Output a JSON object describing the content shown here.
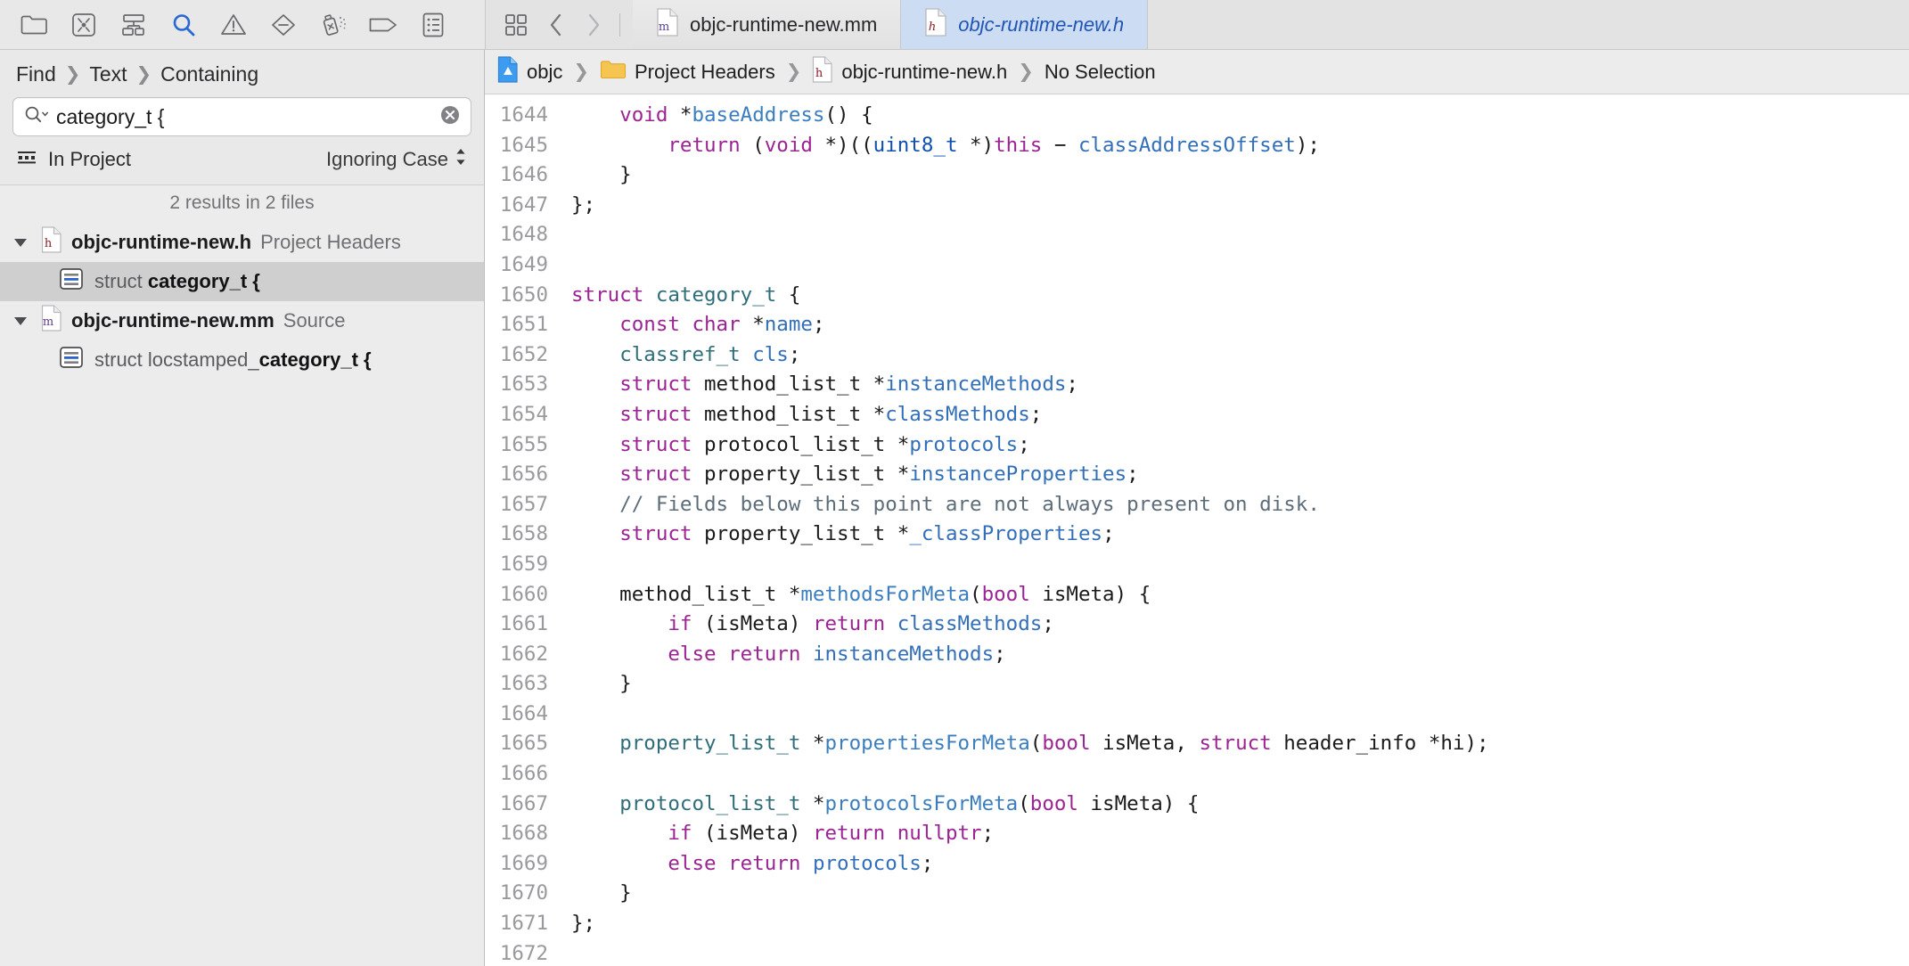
{
  "navigator_toolbar": {
    "icons": [
      {
        "name": "folder-icon",
        "title": "Project navigator"
      },
      {
        "name": "source-control-icon",
        "title": "Source control navigator"
      },
      {
        "name": "hierarchy-icon",
        "title": "Symbol navigator"
      },
      {
        "name": "search-icon",
        "title": "Find navigator"
      },
      {
        "name": "warning-triangle-icon",
        "title": "Issue navigator"
      },
      {
        "name": "diamond-minus-icon",
        "title": "Test navigator"
      },
      {
        "name": "spray-can-icon",
        "title": "Debug navigator"
      },
      {
        "name": "tag-icon",
        "title": "Breakpoint navigator"
      },
      {
        "name": "report-list-icon",
        "title": "Report navigator"
      }
    ],
    "selected_icon": "search-icon"
  },
  "editor_toolbar": {
    "grid_icon": "grid-squares-icon",
    "back_icon": "chevron-left-icon",
    "forward_icon": "chevron-right-icon"
  },
  "tabs": [
    {
      "label": "objc-runtime-new.mm",
      "badge": "m",
      "badge_color": "#5c3d8f",
      "active": false
    },
    {
      "label": "objc-runtime-new.h",
      "badge": "h",
      "badge_color": "#8d1b22",
      "active": true
    }
  ],
  "find": {
    "breadcrumb": [
      "Find",
      "Text",
      "Containing"
    ],
    "breadcrumb_sep": "›",
    "search_value": "category_t {",
    "search_placeholder": "Search",
    "scope_label": "In Project",
    "scope_icon": "scope-icon",
    "options_label": "Ignoring Case",
    "options_icon": "updown-chevron-icon",
    "clear_icon": "clear-circle-icon",
    "results_summary": "2 results in 2 files",
    "results": [
      {
        "file": "objc-runtime-new.h",
        "kind": "Project Headers",
        "badge": "h",
        "badge_color": "#8d1b22",
        "expanded": true,
        "matches": [
          {
            "prefix": "struct ",
            "match": "category_t {",
            "suffix": "",
            "selected": true
          }
        ]
      },
      {
        "file": "objc-runtime-new.mm",
        "kind": "Source",
        "badge": "m",
        "badge_color": "#5c3d8f",
        "expanded": true,
        "matches": [
          {
            "prefix": "struct locstamped_",
            "match": "category_t {",
            "suffix": "",
            "selected": false
          }
        ]
      }
    ]
  },
  "editor": {
    "breadcrumb": [
      {
        "label": "objc",
        "icon": "xcode-project-icon"
      },
      {
        "label": "Project Headers",
        "icon": "folder-icon"
      },
      {
        "label": "objc-runtime-new.h",
        "icon": "header-file-icon"
      },
      {
        "label": "No Selection",
        "icon": null
      }
    ],
    "breadcrumb_sep": "›",
    "first_line_number": 1644,
    "lines": [
      {
        "n": 1644,
        "spans": [
          {
            "t": "    ",
            "c": "pn"
          },
          {
            "t": "void",
            "c": "k"
          },
          {
            "t": " *",
            "c": "pn"
          },
          {
            "t": "baseAddress",
            "c": "fnb"
          },
          {
            "t": "() {",
            "c": "pn"
          }
        ]
      },
      {
        "n": 1645,
        "spans": [
          {
            "t": "        ",
            "c": "pn"
          },
          {
            "t": "return",
            "c": "k"
          },
          {
            "t": " (",
            "c": "pn"
          },
          {
            "t": "void",
            "c": "k"
          },
          {
            "t": " *)((",
            "c": "pn"
          },
          {
            "t": "uint8_t",
            "c": "kd"
          },
          {
            "t": " *)",
            "c": "pn"
          },
          {
            "t": "this",
            "c": "k"
          },
          {
            "t": " − ",
            "c": "pn"
          },
          {
            "t": "classAddressOffset",
            "c": "id"
          },
          {
            "t": ");",
            "c": "pn"
          }
        ]
      },
      {
        "n": 1646,
        "spans": [
          {
            "t": "    }",
            "c": "pn"
          }
        ]
      },
      {
        "n": 1647,
        "spans": [
          {
            "t": "};",
            "c": "pn"
          }
        ]
      },
      {
        "n": 1648,
        "spans": []
      },
      {
        "n": 1649,
        "spans": []
      },
      {
        "n": 1650,
        "spans": [
          {
            "t": "struct",
            "c": "k"
          },
          {
            "t": " ",
            "c": "pn"
          },
          {
            "t": "category_t",
            "c": "ty"
          },
          {
            "t": " {",
            "c": "pn"
          }
        ]
      },
      {
        "n": 1651,
        "spans": [
          {
            "t": "    ",
            "c": "pn"
          },
          {
            "t": "const",
            "c": "k"
          },
          {
            "t": " ",
            "c": "pn"
          },
          {
            "t": "char",
            "c": "k"
          },
          {
            "t": " *",
            "c": "pn"
          },
          {
            "t": "name",
            "c": "id"
          },
          {
            "t": ";",
            "c": "pn"
          }
        ]
      },
      {
        "n": 1652,
        "spans": [
          {
            "t": "    ",
            "c": "pn"
          },
          {
            "t": "classref_t",
            "c": "ty"
          },
          {
            "t": " ",
            "c": "pn"
          },
          {
            "t": "cls",
            "c": "id"
          },
          {
            "t": ";",
            "c": "pn"
          }
        ]
      },
      {
        "n": 1653,
        "spans": [
          {
            "t": "    ",
            "c": "pn"
          },
          {
            "t": "struct",
            "c": "k"
          },
          {
            "t": " method_list_t *",
            "c": "pn"
          },
          {
            "t": "instanceMethods",
            "c": "id"
          },
          {
            "t": ";",
            "c": "pn"
          }
        ]
      },
      {
        "n": 1654,
        "spans": [
          {
            "t": "    ",
            "c": "pn"
          },
          {
            "t": "struct",
            "c": "k"
          },
          {
            "t": " method_list_t *",
            "c": "pn"
          },
          {
            "t": "classMethods",
            "c": "id"
          },
          {
            "t": ";",
            "c": "pn"
          }
        ]
      },
      {
        "n": 1655,
        "spans": [
          {
            "t": "    ",
            "c": "pn"
          },
          {
            "t": "struct",
            "c": "k"
          },
          {
            "t": " protocol_list_t *",
            "c": "pn"
          },
          {
            "t": "protocols",
            "c": "id"
          },
          {
            "t": ";",
            "c": "pn"
          }
        ]
      },
      {
        "n": 1656,
        "spans": [
          {
            "t": "    ",
            "c": "pn"
          },
          {
            "t": "struct",
            "c": "k"
          },
          {
            "t": " property_list_t *",
            "c": "pn"
          },
          {
            "t": "instanceProperties",
            "c": "id"
          },
          {
            "t": ";",
            "c": "pn"
          }
        ]
      },
      {
        "n": 1657,
        "spans": [
          {
            "t": "    ",
            "c": "pn"
          },
          {
            "t": "// Fields below this point are not always present on disk.",
            "c": "cm"
          }
        ]
      },
      {
        "n": 1658,
        "spans": [
          {
            "t": "    ",
            "c": "pn"
          },
          {
            "t": "struct",
            "c": "k"
          },
          {
            "t": " property_list_t *",
            "c": "pn"
          },
          {
            "t": "_classProperties",
            "c": "id"
          },
          {
            "t": ";",
            "c": "pn"
          }
        ]
      },
      {
        "n": 1659,
        "spans": []
      },
      {
        "n": 1660,
        "spans": [
          {
            "t": "    method_list_t *",
            "c": "pn"
          },
          {
            "t": "methodsForMeta",
            "c": "fnb"
          },
          {
            "t": "(",
            "c": "pn"
          },
          {
            "t": "bool",
            "c": "k"
          },
          {
            "t": " isMeta) {",
            "c": "pn"
          }
        ]
      },
      {
        "n": 1661,
        "spans": [
          {
            "t": "        ",
            "c": "pn"
          },
          {
            "t": "if",
            "c": "k"
          },
          {
            "t": " (isMeta) ",
            "c": "pn"
          },
          {
            "t": "return",
            "c": "k"
          },
          {
            "t": " ",
            "c": "pn"
          },
          {
            "t": "classMethods",
            "c": "id"
          },
          {
            "t": ";",
            "c": "pn"
          }
        ]
      },
      {
        "n": 1662,
        "spans": [
          {
            "t": "        ",
            "c": "pn"
          },
          {
            "t": "else",
            "c": "k"
          },
          {
            "t": " ",
            "c": "pn"
          },
          {
            "t": "return",
            "c": "k"
          },
          {
            "t": " ",
            "c": "pn"
          },
          {
            "t": "instanceMethods",
            "c": "id"
          },
          {
            "t": ";",
            "c": "pn"
          }
        ]
      },
      {
        "n": 1663,
        "spans": [
          {
            "t": "    }",
            "c": "pn"
          }
        ]
      },
      {
        "n": 1664,
        "spans": []
      },
      {
        "n": 1665,
        "spans": [
          {
            "t": "    ",
            "c": "pn"
          },
          {
            "t": "property_list_t",
            "c": "ty"
          },
          {
            "t": " *",
            "c": "pn"
          },
          {
            "t": "propertiesForMeta",
            "c": "fnb"
          },
          {
            "t": "(",
            "c": "pn"
          },
          {
            "t": "bool",
            "c": "k"
          },
          {
            "t": " isMeta, ",
            "c": "pn"
          },
          {
            "t": "struct",
            "c": "k"
          },
          {
            "t": " header_info *hi);",
            "c": "pn"
          }
        ]
      },
      {
        "n": 1666,
        "spans": []
      },
      {
        "n": 1667,
        "spans": [
          {
            "t": "    ",
            "c": "pn"
          },
          {
            "t": "protocol_list_t",
            "c": "ty"
          },
          {
            "t": " *",
            "c": "pn"
          },
          {
            "t": "protocolsForMeta",
            "c": "fnb"
          },
          {
            "t": "(",
            "c": "pn"
          },
          {
            "t": "bool",
            "c": "k"
          },
          {
            "t": " isMeta) {",
            "c": "pn"
          }
        ]
      },
      {
        "n": 1668,
        "spans": [
          {
            "t": "        ",
            "c": "pn"
          },
          {
            "t": "if",
            "c": "k"
          },
          {
            "t": " (isMeta) ",
            "c": "pn"
          },
          {
            "t": "return",
            "c": "k"
          },
          {
            "t": " ",
            "c": "pn"
          },
          {
            "t": "nullptr",
            "c": "k"
          },
          {
            "t": ";",
            "c": "pn"
          }
        ]
      },
      {
        "n": 1669,
        "spans": [
          {
            "t": "        ",
            "c": "pn"
          },
          {
            "t": "else",
            "c": "k"
          },
          {
            "t": " ",
            "c": "pn"
          },
          {
            "t": "return",
            "c": "k"
          },
          {
            "t": " ",
            "c": "pn"
          },
          {
            "t": "protocols",
            "c": "id"
          },
          {
            "t": ";",
            "c": "pn"
          }
        ]
      },
      {
        "n": 1670,
        "spans": [
          {
            "t": "    }",
            "c": "pn"
          }
        ]
      },
      {
        "n": 1671,
        "spans": [
          {
            "t": "};",
            "c": "pn"
          }
        ]
      },
      {
        "n": 1672,
        "spans": []
      }
    ]
  },
  "colors": {
    "accent": "#2155b5",
    "keyword": "#9b2393",
    "type": "#2e6d79",
    "identifier": "#326fb8",
    "comment": "#5d6c79",
    "selection": "#cfcfcf",
    "tab_active_bg": "#cbdcf3"
  }
}
